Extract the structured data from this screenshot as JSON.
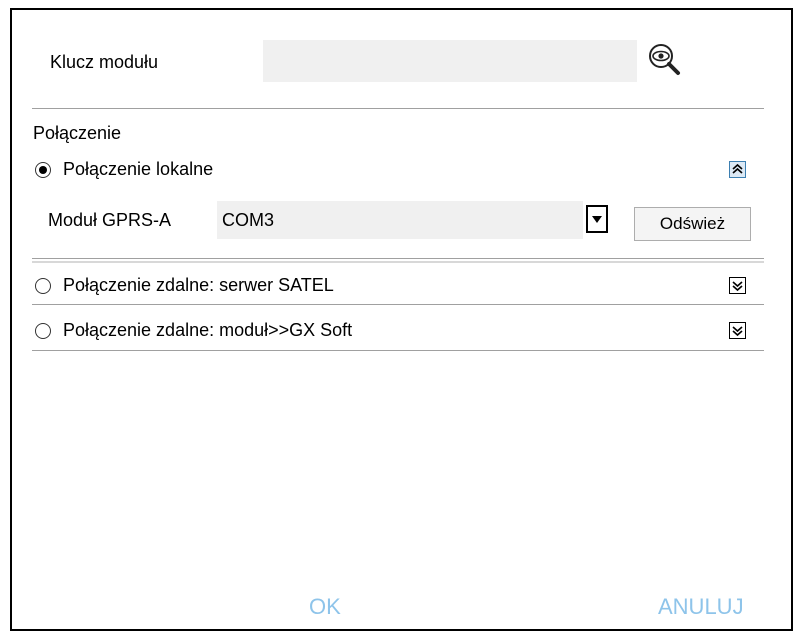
{
  "module_key": {
    "label": "Klucz modułu",
    "value": ""
  },
  "connection": {
    "section_title": "Połączenie",
    "options": [
      {
        "label": "Połączenie lokalne",
        "selected": true,
        "expander": "collapse-icon"
      },
      {
        "label": "Połączenie zdalne: serwer SATEL",
        "selected": false,
        "expander": "expand-icon"
      },
      {
        "label": "Połączenie zdalne: moduł>>GX Soft",
        "selected": false,
        "expander": "expand-icon"
      }
    ],
    "local": {
      "module_label": "Moduł GPRS-A",
      "port_value": "COM3",
      "refresh_label": "Odśwież"
    }
  },
  "footer": {
    "ok_label": "OK",
    "cancel_label": "ANULUJ"
  },
  "colors": {
    "disabled_text": "#8ec4ea",
    "field_bg": "#f0f0f0",
    "expander_active_bg": "#dce9f5"
  }
}
